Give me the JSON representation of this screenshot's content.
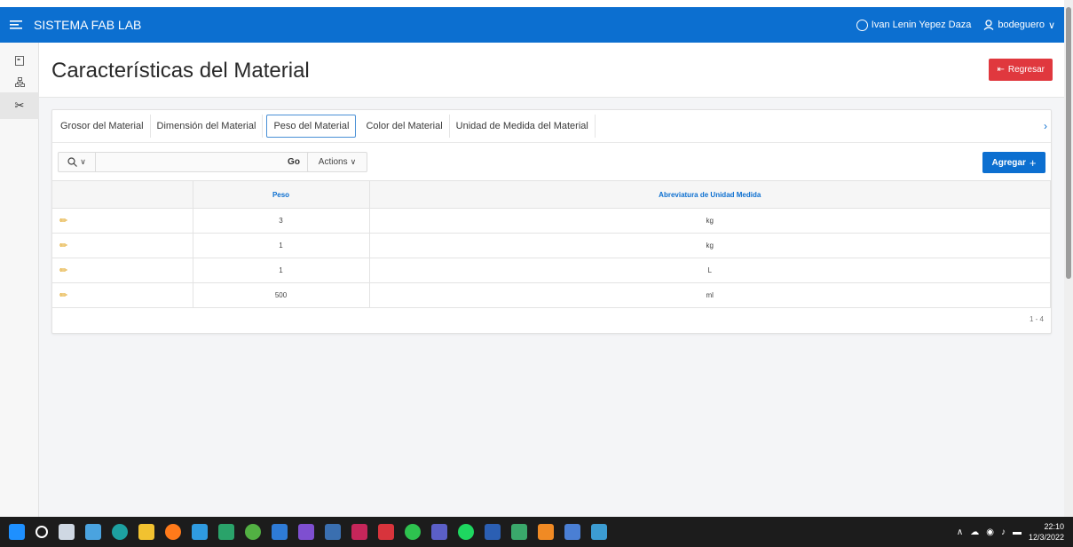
{
  "header": {
    "menu_icon": "hamburger-icon",
    "app_title": "SISTEMA FAB LAB",
    "user_full_name": "Ivan Lenin Yepez Daza",
    "username": "bodeguero",
    "color": "#0c6fd0"
  },
  "sidebar": {
    "items": [
      {
        "icon": "page-icon"
      },
      {
        "icon": "network-icon"
      },
      {
        "icon": "tools-icon"
      }
    ]
  },
  "page": {
    "title": "Características del Material",
    "back_label": "Regresar",
    "back_color": "#e0383e"
  },
  "tabs": [
    {
      "label": "Grosor del Material"
    },
    {
      "label": "Dimensión del Material"
    },
    {
      "label": "Peso del Material",
      "active": true
    },
    {
      "label": "Color del Material"
    },
    {
      "label": "Unidad de Medida del Material"
    }
  ],
  "toolbar": {
    "search_value": "",
    "go_label": "Go",
    "actions_label": "Actions",
    "add_label": "Agregar"
  },
  "table": {
    "columns": [
      "",
      "Peso",
      "Abreviatura de Unidad Medida"
    ],
    "rows": [
      {
        "peso": "3",
        "unidad": "kg"
      },
      {
        "peso": "1",
        "unidad": "kg"
      },
      {
        "peso": "1",
        "unidad": "L"
      },
      {
        "peso": "500",
        "unidad": "ml"
      }
    ],
    "pagination": "1 - 4"
  },
  "taskbar": {
    "time": "22:10",
    "date": "12/3/2022"
  }
}
